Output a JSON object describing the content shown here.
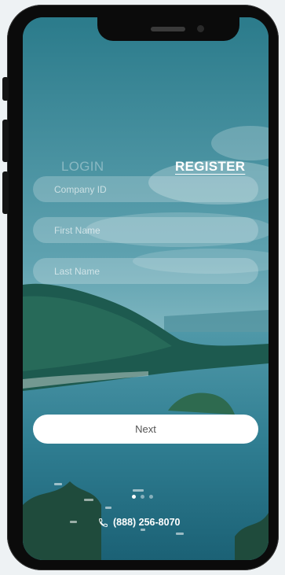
{
  "tabs": {
    "login": "LOGIN",
    "register": "REGISTER",
    "active": "register"
  },
  "form": {
    "company_id": {
      "placeholder": "Company ID",
      "value": ""
    },
    "first_name": {
      "placeholder": "First Name",
      "value": ""
    },
    "last_name": {
      "placeholder": "Last Name",
      "value": ""
    }
  },
  "next_label": "Next",
  "pager": {
    "count": 3,
    "active_index": 0
  },
  "contact": {
    "phone": "(888) 256-8070",
    "icon": "phone-icon"
  },
  "colors": {
    "accent": "#ffffff",
    "background_teal": "#3f8e9c"
  }
}
